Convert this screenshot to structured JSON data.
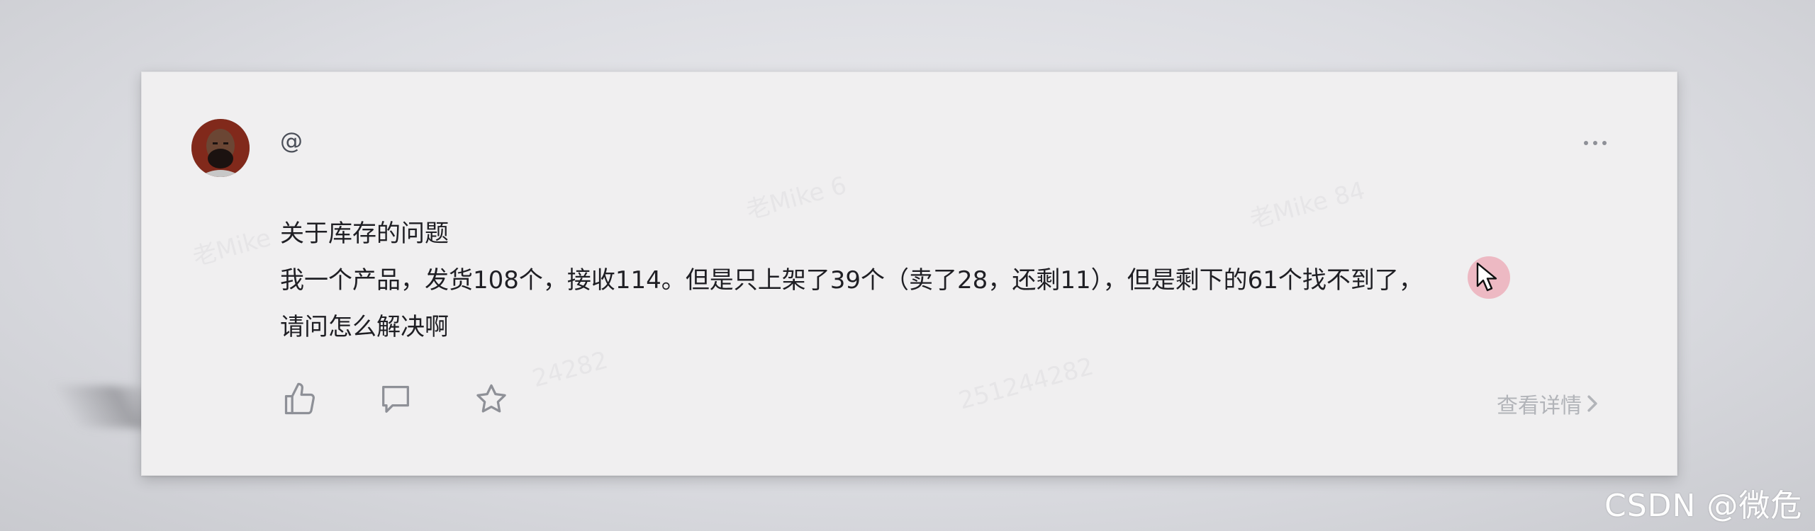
{
  "post": {
    "username": "@",
    "title": "关于库存的问题",
    "body_line_1": "我一个产品，发货108个，接收114。但是只上架了39个（卖了28，还剩11），但是剩下的61个找不到了，",
    "body_line_2": "请问怎么解决啊",
    "detail_link": "查看详情"
  },
  "icons": {
    "avatar": "avatar",
    "more": "more-dots-icon",
    "like": "thumbs-up-icon",
    "comment": "comment-icon",
    "favorite": "star-icon",
    "detail_arrow": "chevron-right-icon",
    "cursor": "mouse-cursor-icon"
  },
  "footer": {
    "csdn_watermark": "CSDN @微危"
  },
  "colors": {
    "card_bg": "#f0eff0",
    "text": "#1f1f24",
    "muted": "#b2b4b9",
    "icon": "#8e9097",
    "cursor_halo": "#e8788c"
  }
}
